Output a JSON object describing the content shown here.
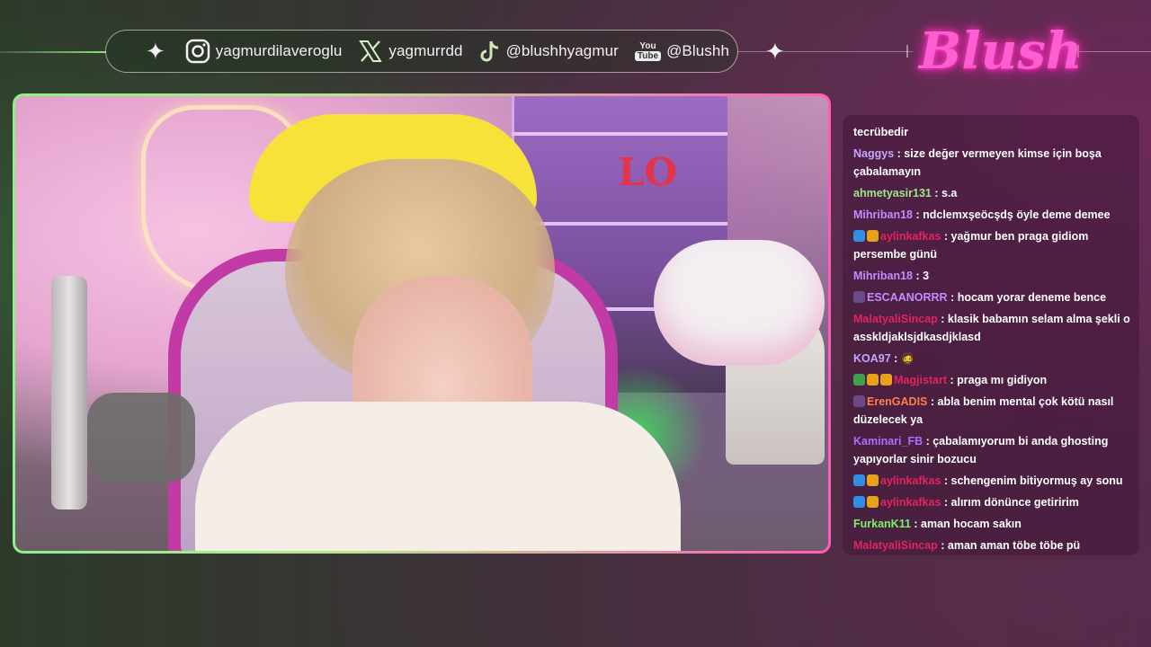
{
  "social_bar": {
    "items": [
      {
        "icon": "instagram-icon",
        "text": "yagmurdilaveroglu"
      },
      {
        "icon": "x-icon",
        "text": "yagmurrdd"
      },
      {
        "icon": "tiktok-icon",
        "text": "@blushhyagmur"
      },
      {
        "icon": "youtube-icon",
        "text": "@Blushh",
        "badge_top": "You",
        "badge_bottom": "Tube"
      }
    ]
  },
  "logo": {
    "text": "Blush"
  },
  "video": {
    "love_sign": "LO"
  },
  "chat": {
    "messages": [
      {
        "user": "",
        "color": "#ffffff",
        "badges": [],
        "text": "tecrübedir"
      },
      {
        "user": "Naggys",
        "color": "#c4a6ff",
        "badges": [],
        "text": "size değer vermeyen kimse için boşa çabalamayın"
      },
      {
        "user": "ahmetyasir131",
        "color": "#9be88f",
        "badges": [],
        "text": "s.a"
      },
      {
        "user": "Mihriban18",
        "color": "#c08cff",
        "badges": [],
        "text": "ndclemxşeöcşdş öyle deme demee"
      },
      {
        "user": "aylinkafkas",
        "color": "#e0245e",
        "badges": [
          "#2f8fe6",
          "#e8a21a"
        ],
        "text": "yağmur ben praga gidiom persembe günü"
      },
      {
        "user": "Mihriban18",
        "color": "#c08cff",
        "badges": [],
        "text": "3"
      },
      {
        "user": "ESCAANORRR",
        "color": "#c08cff",
        "badges": [
          "#6b4a8a"
        ],
        "text": "hocam yorar deneme bence"
      },
      {
        "user": "MalatyaliSincap",
        "color": "#e0245e",
        "badges": [],
        "text": "klasik babamın selam alma şekli o asskldjaklsjdkasdjklasd"
      },
      {
        "user": "KOA97",
        "color": "#c4a6ff",
        "badges": [],
        "text": "🧔"
      },
      {
        "user": "Magjistart",
        "color": "#e0245e",
        "badges": [
          "#3fa24a",
          "#e8a21a",
          "#e8a21a"
        ],
        "text": "praga mı gidiyon"
      },
      {
        "user": "ErenGADIS",
        "color": "#ff7f50",
        "badges": [
          "#6b4a8a"
        ],
        "text": "abla benim mental çok kötü nasıl düzelecek ya"
      },
      {
        "user": "Kaminari_FB",
        "color": "#b26bff",
        "badges": [],
        "text": "çabalamıyorum bi anda ghosting yapıyorlar sinir bozucu"
      },
      {
        "user": "aylinkafkas",
        "color": "#e0245e",
        "badges": [
          "#2f8fe6",
          "#e8a21a"
        ],
        "text": "schengenim bitiyormuş ay sonu"
      },
      {
        "user": "aylinkafkas",
        "color": "#e0245e",
        "badges": [
          "#2f8fe6",
          "#e8a21a"
        ],
        "text": "alırım dönünce getiririm"
      },
      {
        "user": "FurkanK11",
        "color": "#7cf06a",
        "badges": [],
        "text": "aman hocam sakın"
      },
      {
        "user": "MalatyaliSincap",
        "color": "#e0245e",
        "badges": [],
        "text": "aman aman töbe töbe pü"
      }
    ]
  }
}
